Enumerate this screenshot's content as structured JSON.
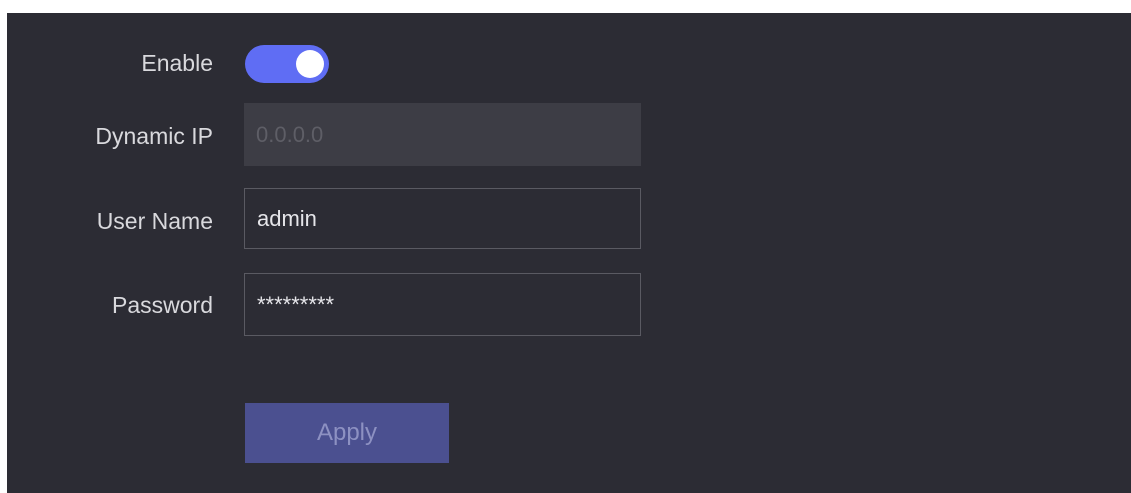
{
  "form": {
    "enable": {
      "label": "Enable",
      "on": true
    },
    "dynamic_ip": {
      "label": "Dynamic IP",
      "value": "0.0.0.0"
    },
    "user_name": {
      "label": "User Name",
      "value": "admin"
    },
    "password": {
      "label": "Password",
      "value": "*********"
    },
    "apply_label": "Apply"
  },
  "colors": {
    "panel_bg": "#2c2c34",
    "toggle_on": "#5f6df4",
    "apply_bg": "#4b5090",
    "disabled_field_bg": "#3d3d45"
  }
}
